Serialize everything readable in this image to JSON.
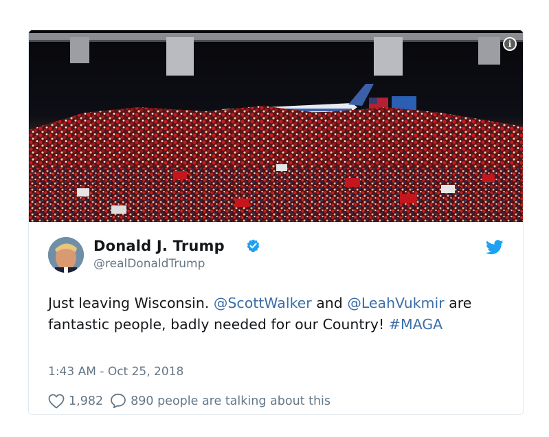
{
  "tweet": {
    "author_name": "Donald J. Trump",
    "handle": "@realDonaldTrump",
    "text_part1": "Just leaving Wisconsin. ",
    "mention1": "@ScottWalker",
    "text_part2": " and ",
    "mention2": "@LeahVukmir",
    "text_part3": " are fantastic people, badly needed for our Country! ",
    "hashtag": "#MAGA",
    "timestamp": "1:43 AM - Oct 25, 2018",
    "like_count": "1,982",
    "talking_text": "890 people are talking about this"
  },
  "icons": {
    "info": "info-icon",
    "verified": "verified-badge-icon",
    "bird": "twitter-bird-icon",
    "heart": "heart-icon",
    "comment": "speech-bubble-icon"
  },
  "media": {
    "info_glyph": "i"
  },
  "colors": {
    "link": "#3b6ea8",
    "verified": "#1da1f2",
    "muted": "#657786",
    "text": "#14171a"
  }
}
